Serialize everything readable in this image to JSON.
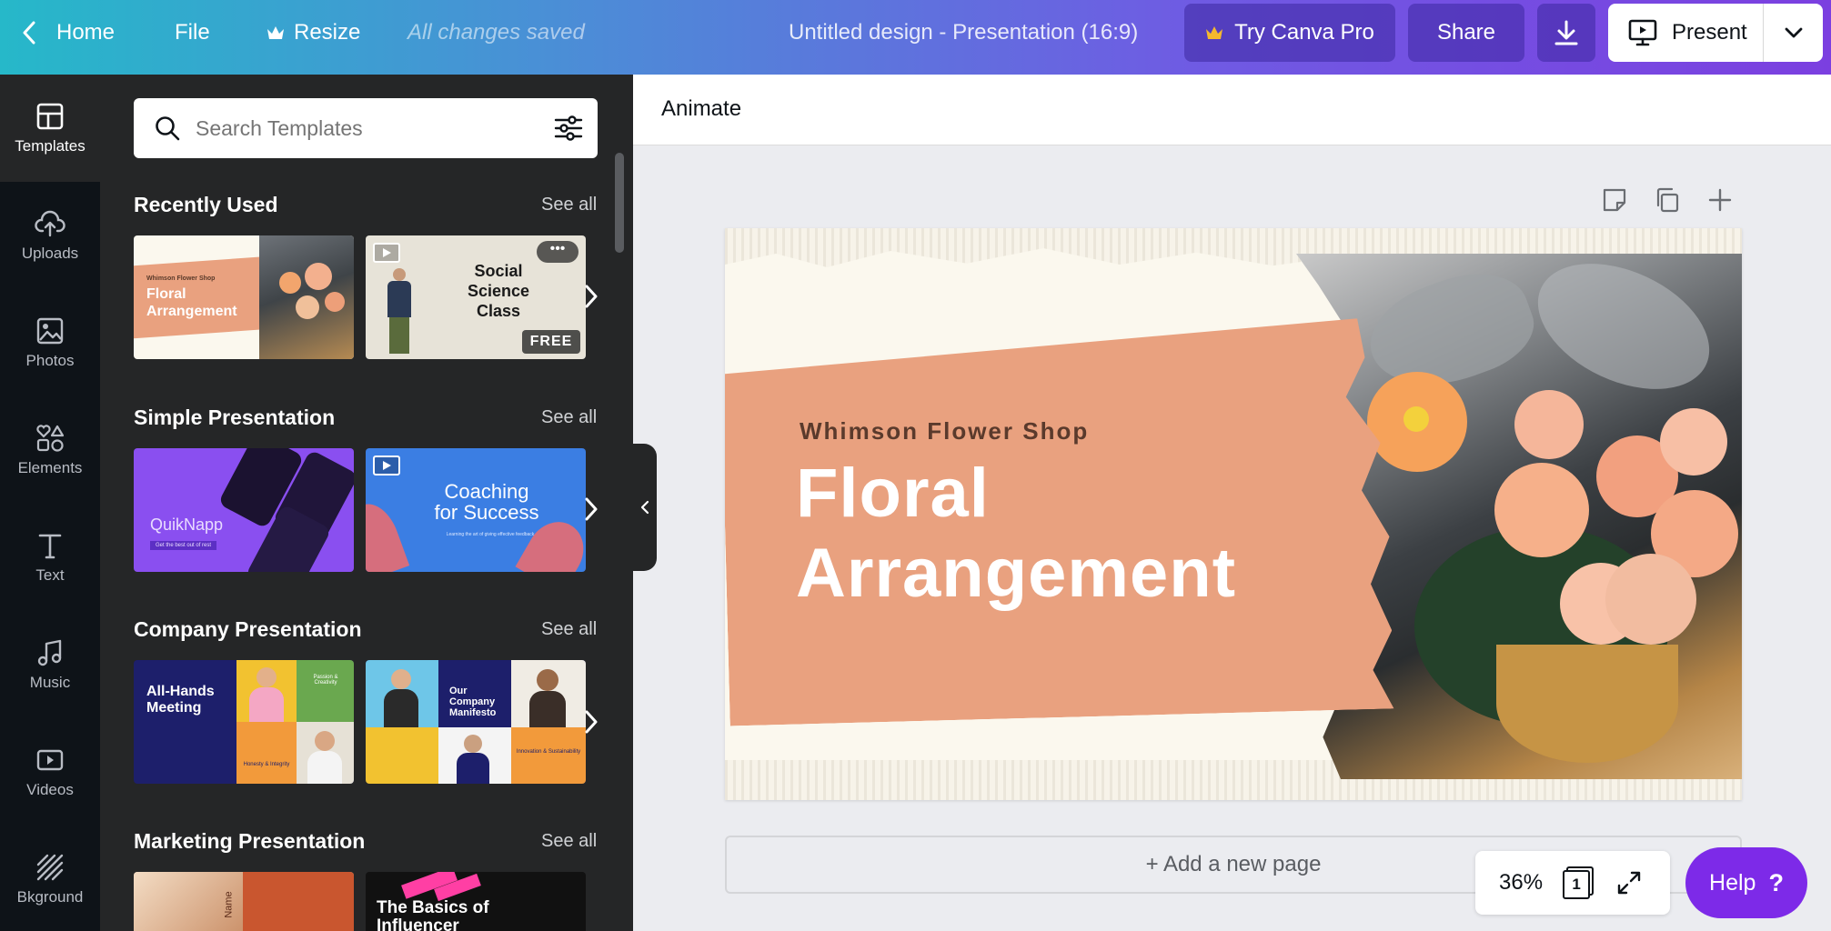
{
  "topbar": {
    "home_label": "Home",
    "file_label": "File",
    "resize_label": "Resize",
    "status": "All changes saved",
    "doc_title": "Untitled design - Presentation (16:9)",
    "try_pro_label": "Try Canva Pro",
    "share_label": "Share",
    "present_label": "Present"
  },
  "rail": [
    {
      "label": "Templates",
      "icon": "templates-icon"
    },
    {
      "label": "Uploads",
      "icon": "upload-cloud-icon"
    },
    {
      "label": "Photos",
      "icon": "photo-icon"
    },
    {
      "label": "Elements",
      "icon": "elements-shapes-icon"
    },
    {
      "label": "Text",
      "icon": "text-t-icon"
    },
    {
      "label": "Music",
      "icon": "music-note-icon"
    },
    {
      "label": "Videos",
      "icon": "video-play-icon"
    },
    {
      "label": "Bkground",
      "icon": "background-stripes-icon"
    }
  ],
  "panel": {
    "search_placeholder": "Search Templates",
    "see_all": "See all",
    "sections": [
      {
        "title": "Recently Used",
        "thumbs": [
          {
            "line1": "Whimson Flower Shop",
            "line2": "Floral",
            "line3": "Arrangement"
          },
          {
            "line1": "Social",
            "line2": "Science",
            "line3": "Class",
            "badge": "FREE"
          }
        ]
      },
      {
        "title": "Simple Presentation",
        "thumbs": [
          {
            "line1": "QuikNapp",
            "line2": "Get the best out of rest"
          },
          {
            "line1": "Coaching",
            "line2": "for Success",
            "line3": "Learning the art of giving effective feedback"
          }
        ]
      },
      {
        "title": "Company Presentation",
        "thumbs": [
          {
            "line1": "All-Hands",
            "line2": "Meeting",
            "line3": "Passion & Creativity",
            "line4": "Honesty & Integrity"
          },
          {
            "line1": "Our",
            "line2": "Company",
            "line3": "Manifesto",
            "line4": "Innovation & Sustainability"
          }
        ]
      },
      {
        "title": "Marketing Presentation",
        "thumbs": [
          {
            "line1": "Name"
          },
          {
            "line1": "The Basics of",
            "line2": "Influencer"
          }
        ]
      }
    ]
  },
  "editor": {
    "animate_label": "Animate",
    "slide": {
      "subtitle": "Whimson Flower Shop",
      "title_line1": "Floral",
      "title_line2": "Arrangement"
    },
    "add_page_label": "+ Add a new page",
    "zoom": "36%",
    "page_count": "1",
    "help_label": "Help",
    "help_icon": "?"
  },
  "colors": {
    "brand_purple": "#7d2ae8",
    "peach": "#e9a17f",
    "panel_dark": "#252627",
    "rail_dark": "#0e1318"
  }
}
